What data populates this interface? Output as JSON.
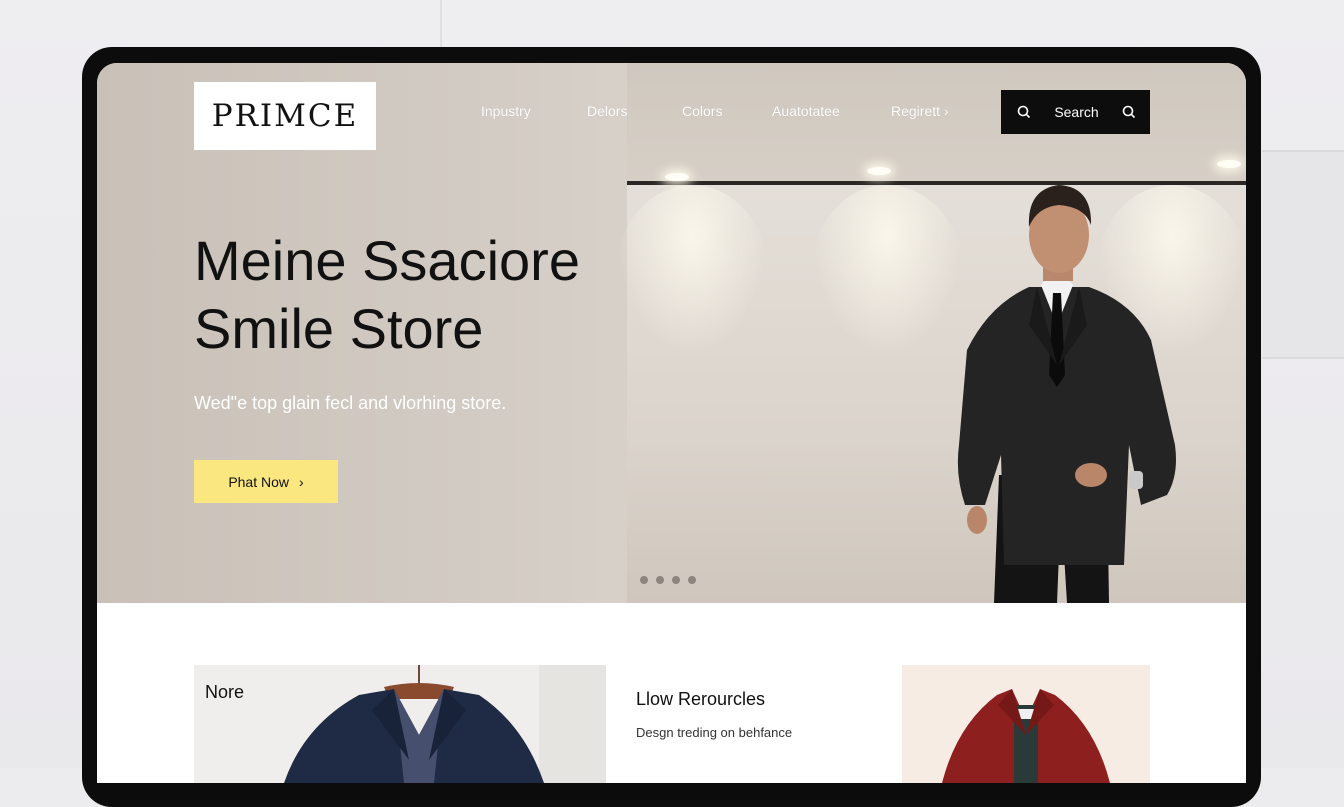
{
  "brand": {
    "logo_text": "PRIMCE"
  },
  "nav": {
    "items": [
      {
        "label": "Inpustry"
      },
      {
        "label": "Delors"
      },
      {
        "label": "Colors"
      },
      {
        "label": "Auatotatee"
      },
      {
        "label": "Regirett ›"
      }
    ]
  },
  "search": {
    "label": "Search"
  },
  "hero": {
    "headline_line1": "Meine Ssaciore",
    "headline_line2": "Smile Store",
    "tagline": "Wed\"e top glain fecl and vlorhing store.",
    "cta_label": "Phat Now",
    "cta_chevron": "›",
    "carousel": {
      "slide_count": 4
    }
  },
  "cards": [
    {
      "title": "Nore"
    },
    {
      "title": "Llow Rerourcles",
      "subtitle": "Desgn treding on behfance"
    },
    {
      "title": ""
    }
  ],
  "colors": {
    "cta_background": "#fbe780",
    "search_background": "#0d0d0d",
    "hero_background": "#d3ccc4"
  }
}
